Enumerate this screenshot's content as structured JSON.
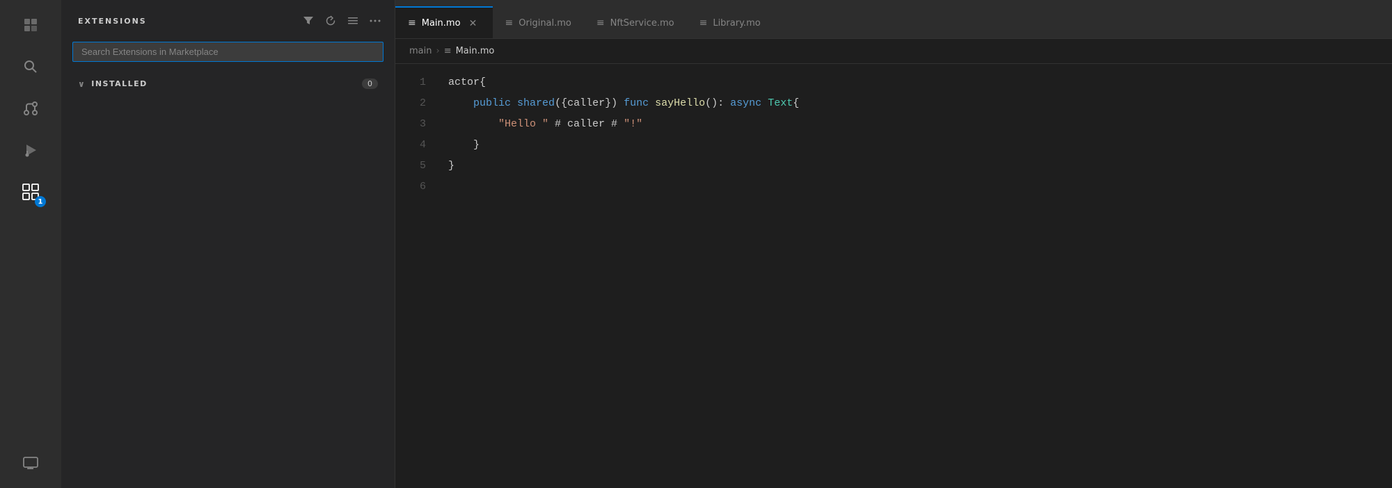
{
  "activityBar": {
    "icons": [
      {
        "name": "explorer-icon",
        "symbol": "⧉",
        "active": false,
        "tooltip": "Explorer"
      },
      {
        "name": "search-icon",
        "symbol": "🔍",
        "active": false,
        "tooltip": "Search"
      },
      {
        "name": "source-control-icon",
        "symbol": "⑂",
        "active": false,
        "tooltip": "Source Control"
      },
      {
        "name": "run-debug-icon",
        "symbol": "▷",
        "active": false,
        "tooltip": "Run and Debug"
      },
      {
        "name": "extensions-icon",
        "symbol": "⊞",
        "active": true,
        "tooltip": "Extensions",
        "badge": "1"
      }
    ]
  },
  "sidebar": {
    "title": "EXTENSIONS",
    "searchPlaceholder": "Search Extensions in Marketplace",
    "actions": [
      {
        "name": "filter-action",
        "symbol": "⊟",
        "tooltip": "Filter Extensions"
      },
      {
        "name": "refresh-action",
        "symbol": "↺",
        "tooltip": "Refresh"
      },
      {
        "name": "clear-action",
        "symbol": "☰",
        "tooltip": "Clear"
      },
      {
        "name": "more-action",
        "symbol": "···",
        "tooltip": "More Actions"
      }
    ],
    "installedSection": {
      "label": "INSTALLED",
      "count": "0"
    }
  },
  "tabs": [
    {
      "name": "main-mo-tab",
      "label": "Main.mo",
      "active": true,
      "closable": true,
      "icon": "≡"
    },
    {
      "name": "original-mo-tab",
      "label": "Original.mo",
      "active": false,
      "closable": false,
      "icon": "≡"
    },
    {
      "name": "nftservice-mo-tab",
      "label": "NftService.mo",
      "active": false,
      "closable": false,
      "icon": "≡"
    },
    {
      "name": "library-mo-tab",
      "label": "Library.mo",
      "active": false,
      "closable": false,
      "icon": "≡"
    }
  ],
  "breadcrumb": {
    "parts": [
      {
        "label": "main",
        "icon": ""
      },
      {
        "sep": "›"
      },
      {
        "label": "Main.mo",
        "icon": "≡"
      }
    ]
  },
  "editor": {
    "lines": [
      {
        "num": 1,
        "tokens": [
          {
            "text": "actor{",
            "class": ""
          }
        ]
      },
      {
        "num": 2,
        "tokens": [
          {
            "text": "    ",
            "class": ""
          },
          {
            "text": "public",
            "class": "kw"
          },
          {
            "text": " ",
            "class": ""
          },
          {
            "text": "shared",
            "class": "kw"
          },
          {
            "text": "({caller}) ",
            "class": ""
          },
          {
            "text": "func",
            "class": "kw"
          },
          {
            "text": " ",
            "class": ""
          },
          {
            "text": "sayHello",
            "class": "fn"
          },
          {
            "text": "(): ",
            "class": ""
          },
          {
            "text": "async",
            "class": "kw"
          },
          {
            "text": " ",
            "class": ""
          },
          {
            "text": "Text",
            "class": "type"
          },
          {
            "text": "{",
            "class": ""
          }
        ]
      },
      {
        "num": 3,
        "tokens": [
          {
            "text": "        ",
            "class": ""
          },
          {
            "text": "\"Hello \"",
            "class": "str"
          },
          {
            "text": " # caller # ",
            "class": ""
          },
          {
            "text": "\"!\"",
            "class": "str"
          }
        ]
      },
      {
        "num": 4,
        "tokens": [
          {
            "text": "    }",
            "class": ""
          }
        ]
      },
      {
        "num": 5,
        "tokens": [
          {
            "text": "}",
            "class": ""
          }
        ]
      },
      {
        "num": 6,
        "tokens": [
          {
            "text": " ",
            "class": ""
          }
        ]
      }
    ]
  }
}
